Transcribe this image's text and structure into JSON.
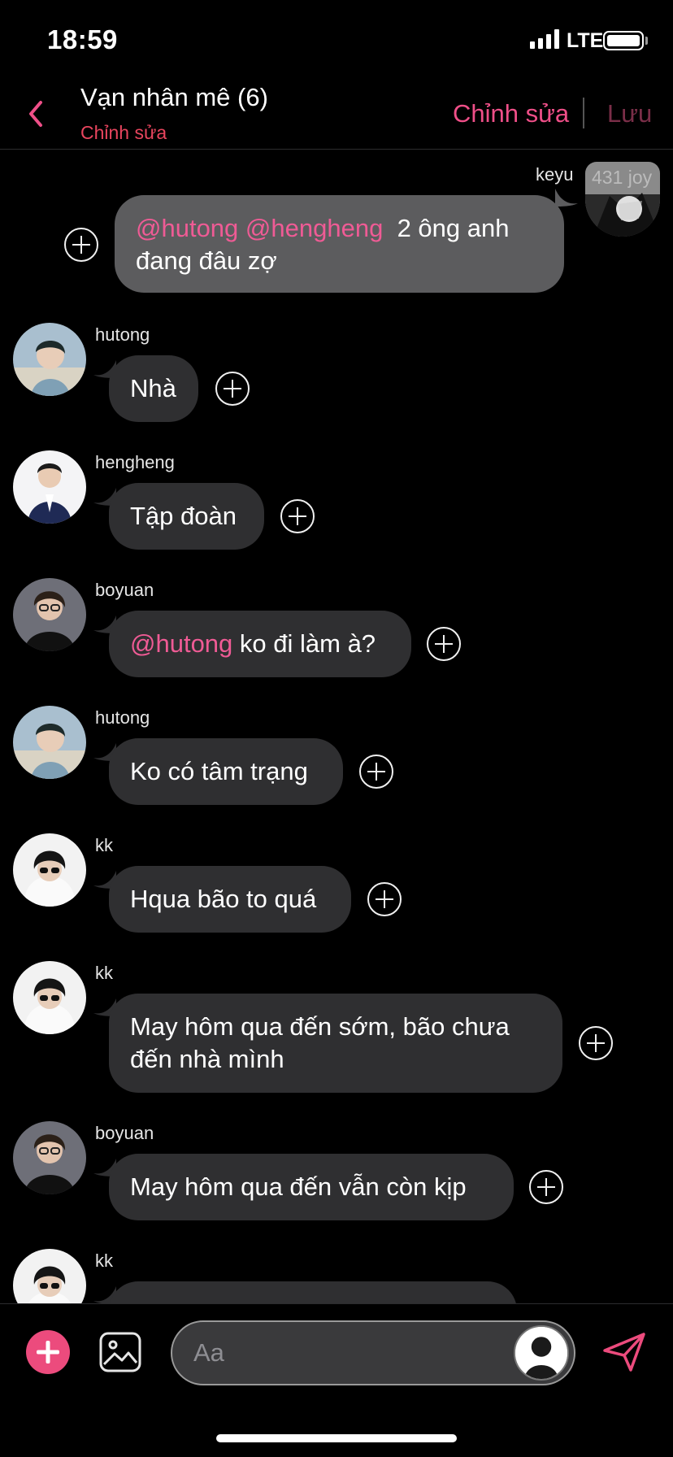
{
  "status_bar": {
    "time": "18:59",
    "network": "LTE"
  },
  "header": {
    "title": "Vạn nhân mê (6)",
    "subtitle": "Chỉnh sửa",
    "edit_label": "Chỉnh sửa",
    "save_label": "Lưu",
    "accent_color": "#ef4f88"
  },
  "self_message": {
    "sender": "keyu",
    "avatar_watermark": "431 joy",
    "mentions": [
      "@hutong",
      "@hengheng"
    ],
    "text_line1": "2 ông anh",
    "text_line2": "đang đâu zợ"
  },
  "messages": [
    {
      "sender": "hutong",
      "text": "Nhà"
    },
    {
      "sender": "hengheng",
      "text": "Tập đoàn"
    },
    {
      "sender": "boyuan",
      "mention": "@hutong",
      "text": " ko đi làm à?"
    },
    {
      "sender": "hutong",
      "text": "Ko có tâm trạng"
    },
    {
      "sender": "kk",
      "text": "Hqua bão to quá"
    },
    {
      "sender": "kk",
      "text_line1": "May hôm qua đến sớm, bão chưa",
      "text_line2": "đến nhà mình"
    },
    {
      "sender": "boyuan",
      "text": "May hôm qua đến vẫn còn kịp"
    },
    {
      "sender": "kk",
      "text": ""
    }
  ],
  "composer": {
    "placeholder": "Aa"
  },
  "icons": {
    "back": "chevron-left-icon",
    "add": "plus-circle-icon",
    "image": "image-icon",
    "send": "paper-plane-icon",
    "reaction": "add-reaction-icon"
  }
}
